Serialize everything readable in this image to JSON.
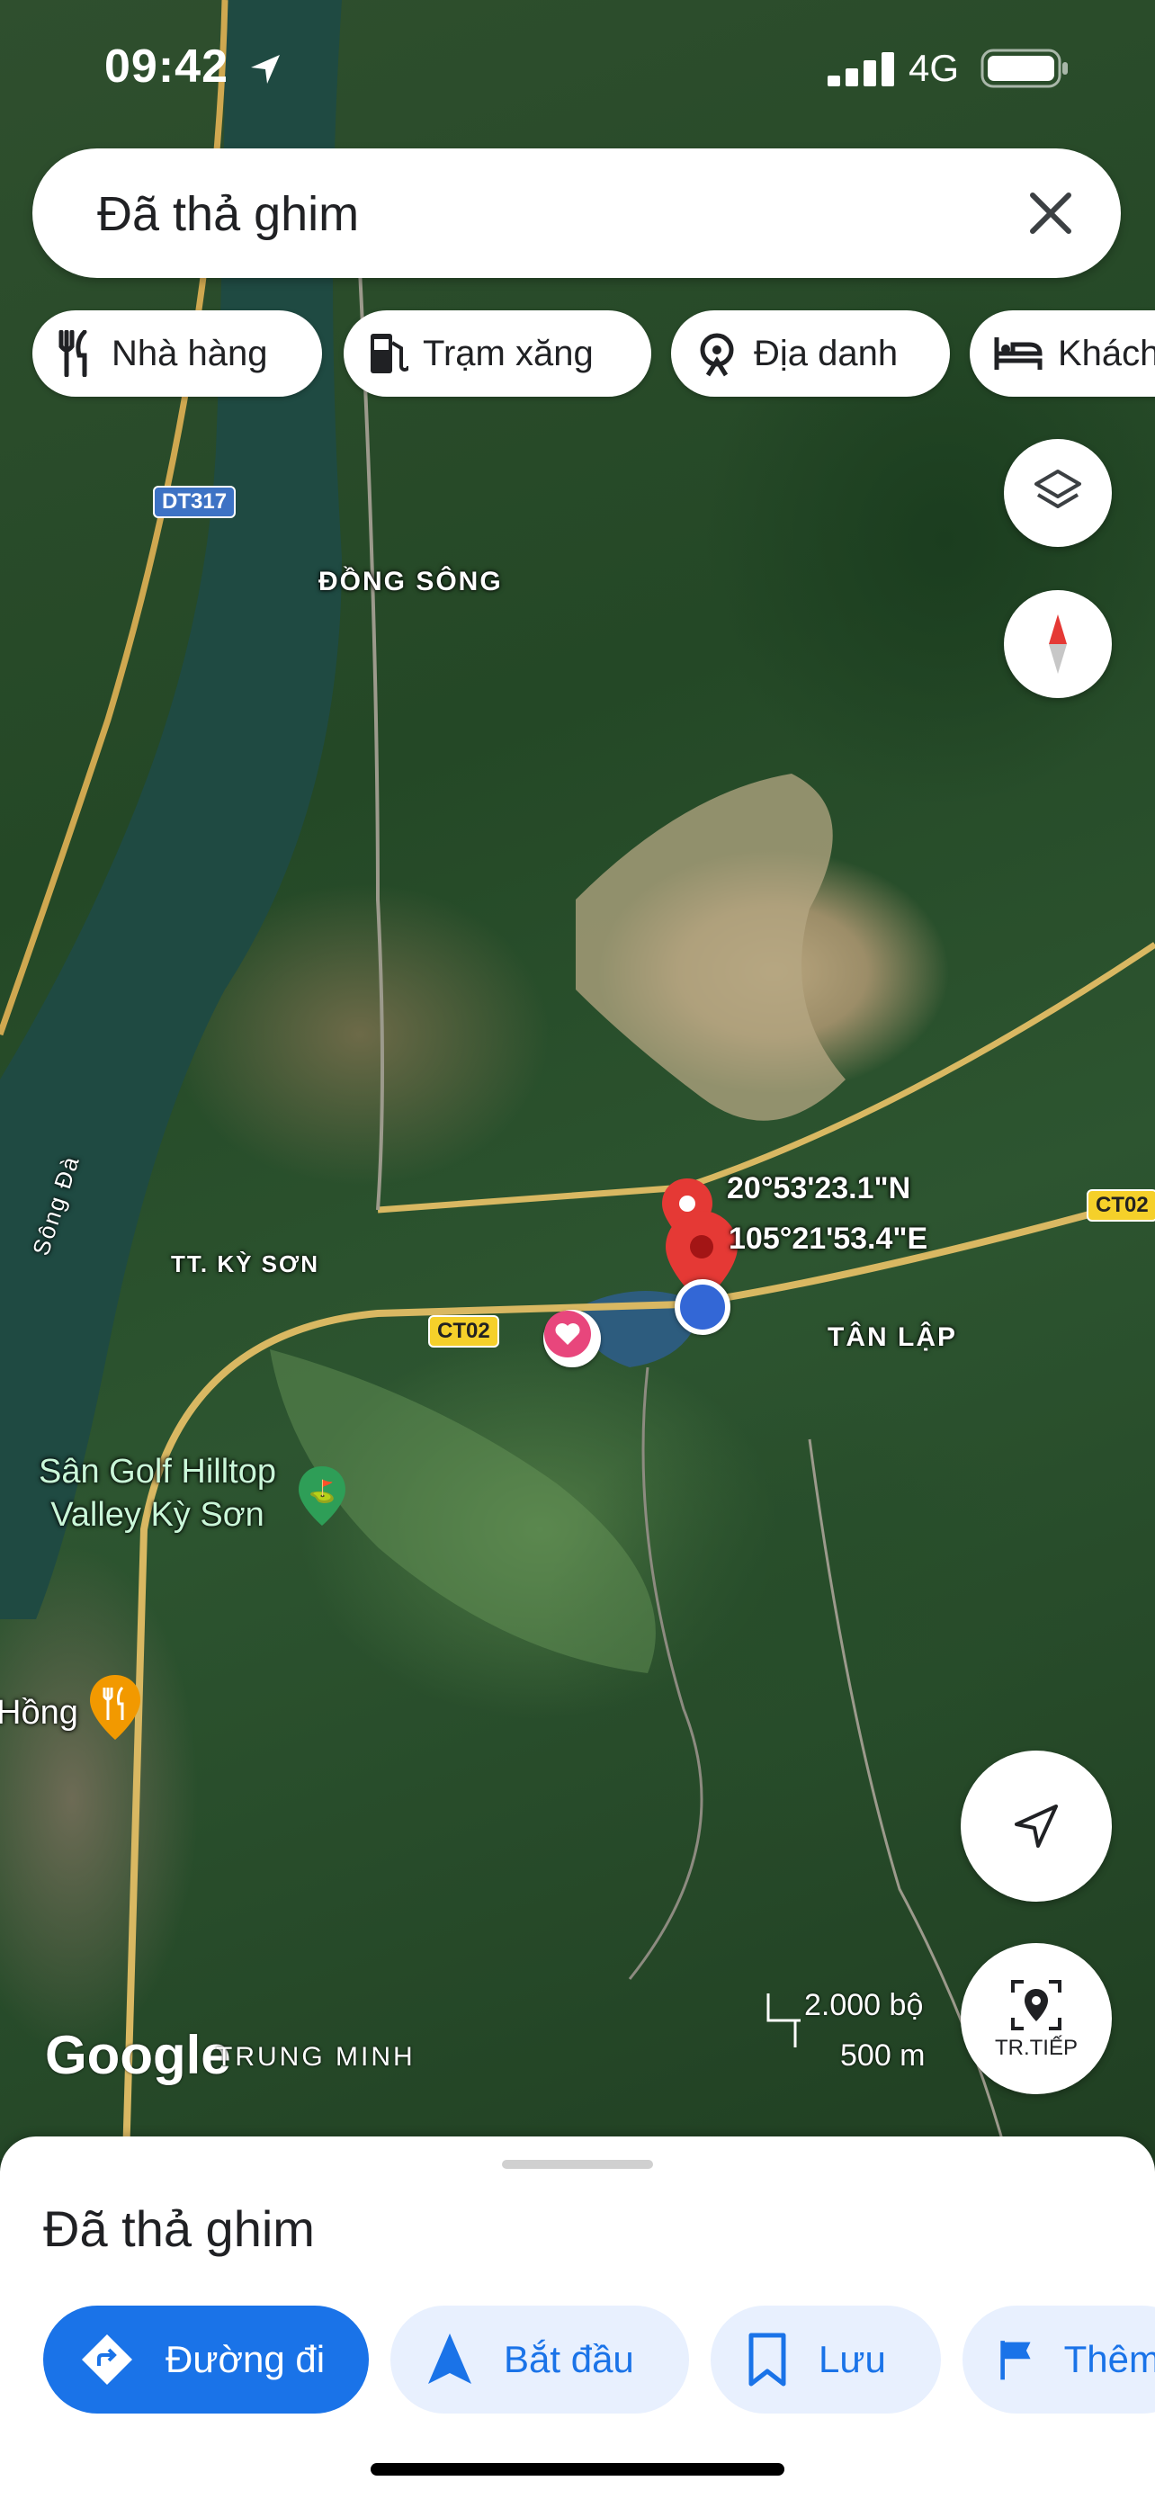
{
  "status_bar": {
    "time": "09:42",
    "network": "4G"
  },
  "search": {
    "text": "Đã thả ghim",
    "close_icon": "close-icon"
  },
  "chips": [
    {
      "label": "Nhà hàng",
      "icon": "restaurant-icon"
    },
    {
      "label": "Trạm xăng",
      "icon": "gas-station-icon"
    },
    {
      "label": "Địa danh",
      "icon": "landmark-icon"
    },
    {
      "label": "Khách",
      "icon": "hotel-icon"
    }
  ],
  "map": {
    "labels": {
      "dong_song": "ĐỒNG SÔNG",
      "tt_ky_son": "TT. KỲ SƠN",
      "tan_lap": "TÂN LẬP",
      "song_da": "Sông Đà",
      "trung_minh": "TRUNG MINH"
    },
    "roads": {
      "dt317": "DT317",
      "ct02_a": "CT02",
      "ct02_b": "CT02"
    },
    "poi_golf": "Sân Golf Hilltop Valley Kỳ Sơn",
    "poi_restaurant": "Hồng",
    "coordinates": {
      "lat": "20°53'23.1\"N",
      "lng": "105°21'53.4\"E"
    },
    "scale": {
      "imperial": "2.000 bộ",
      "metric": "500 m"
    },
    "logo": "Google"
  },
  "buttons": {
    "layers_icon": "layers-icon",
    "compass_icon": "compass-icon",
    "my_location_icon": "navigation-arrow-icon",
    "live_view_label": "TR.TIẾP"
  },
  "sheet": {
    "title": "Đã thả ghim",
    "actions": [
      {
        "label": "Đường đi",
        "icon": "directions-icon"
      },
      {
        "label": "Bắt đầu",
        "icon": "navigate-icon"
      },
      {
        "label": "Lưu",
        "icon": "bookmark-icon"
      },
      {
        "label": "Thêm",
        "icon": "flag-icon"
      }
    ]
  },
  "colors": {
    "accent": "#1a73e8",
    "pin_red": "#e53935",
    "location_blue": "#3367d6"
  }
}
